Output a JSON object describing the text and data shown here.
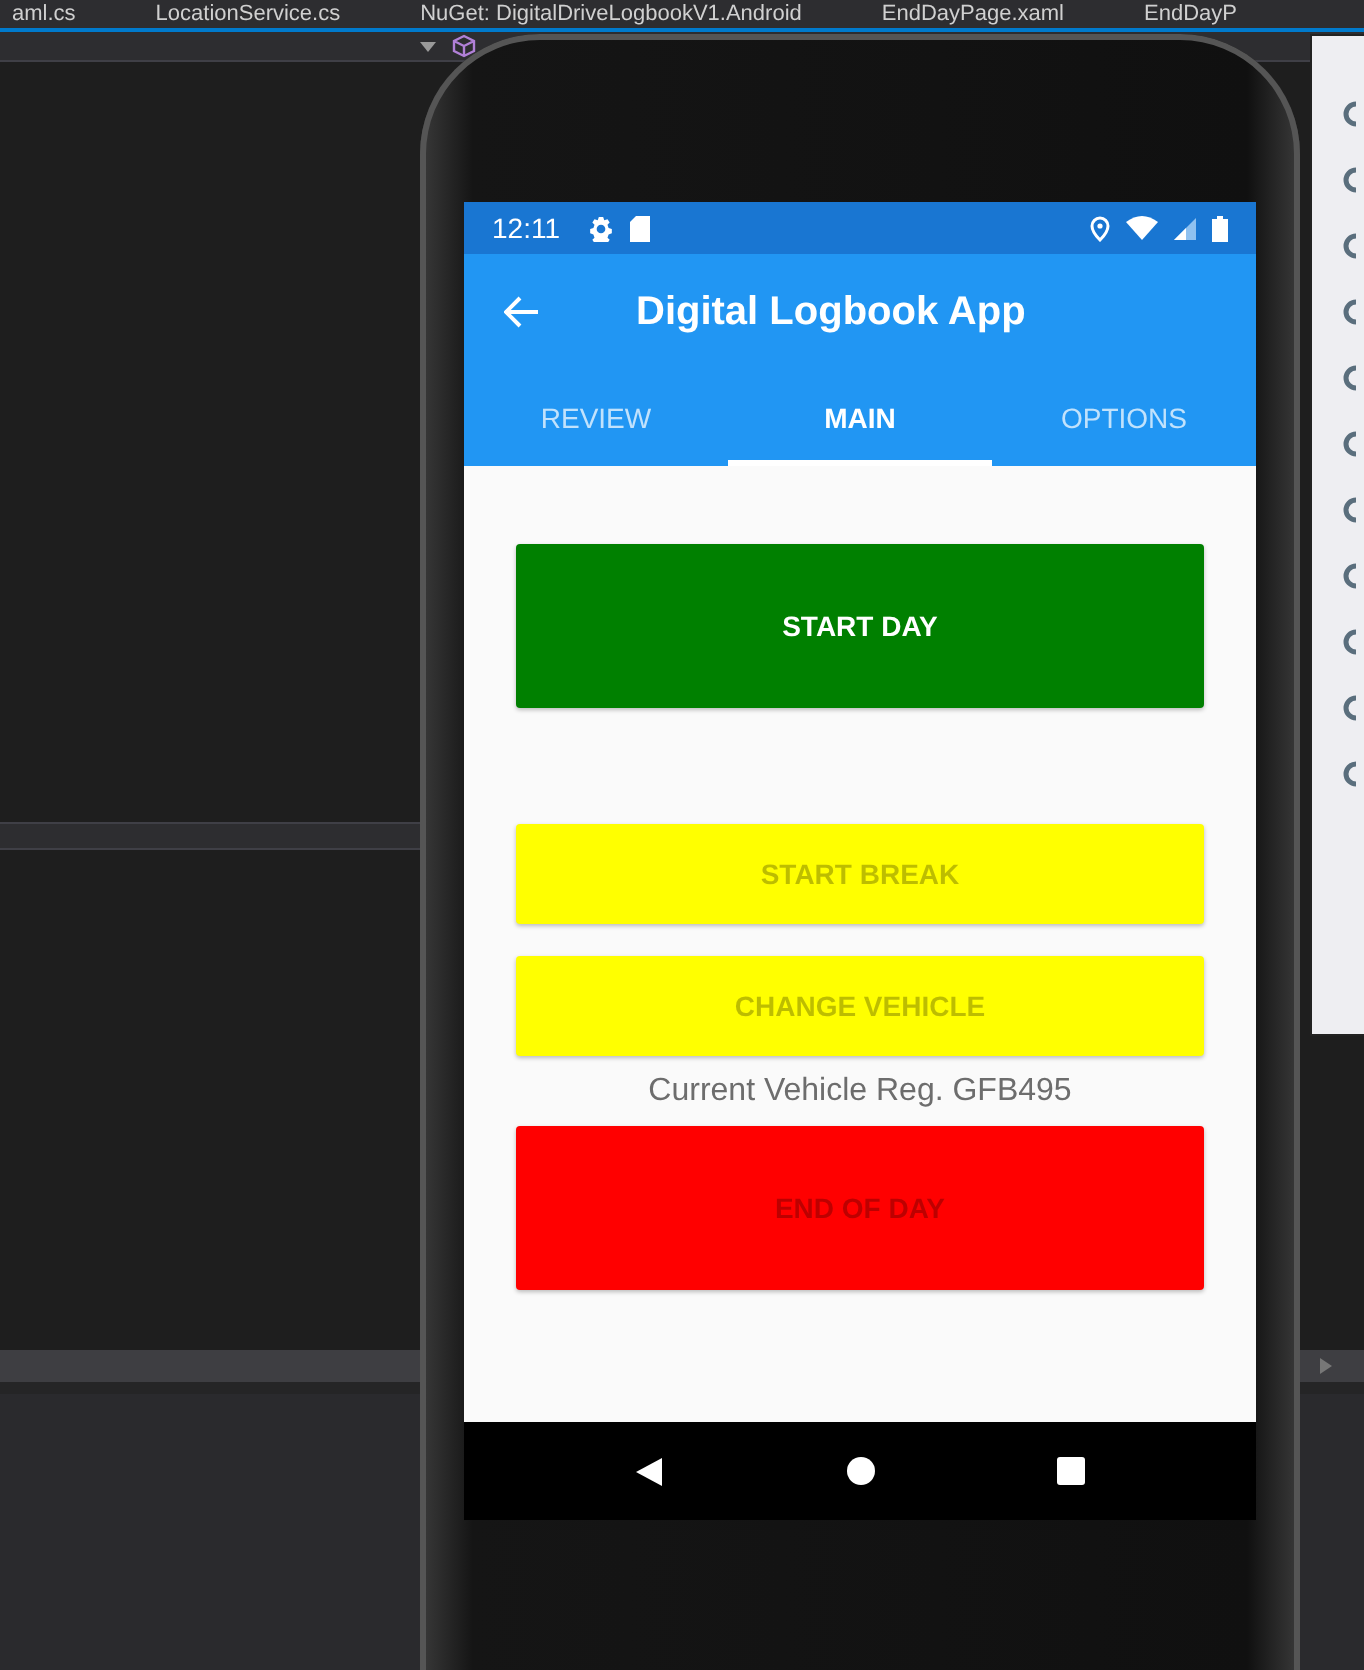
{
  "editor_tabs": [
    {
      "label": "aml.cs"
    },
    {
      "label": "LocationService.cs"
    },
    {
      "label": "NuGet: DigitalDriveLogbookV1.Android"
    },
    {
      "label": "EndDayPage.xaml"
    },
    {
      "label": "EndDayP"
    }
  ],
  "status_bar": {
    "time": "12:11"
  },
  "app_bar": {
    "title": "Digital Logbook App"
  },
  "tabs": [
    {
      "label": "REVIEW",
      "selected": false
    },
    {
      "label": "MAIN",
      "selected": true
    },
    {
      "label": "OPTIONS",
      "selected": false
    }
  ],
  "buttons": [
    {
      "label": "START DAY",
      "color": "#008000",
      "disabled": false
    },
    {
      "label": "START BREAK",
      "color": "#ffff00",
      "disabled": true
    },
    {
      "label": "CHANGE VEHICLE",
      "color": "#ffff00",
      "disabled": true
    },
    {
      "label": "END OF DAY",
      "color": "#ff0000",
      "disabled": true
    }
  ],
  "vehicle_label": "Current Vehicle Reg.  GFB495"
}
